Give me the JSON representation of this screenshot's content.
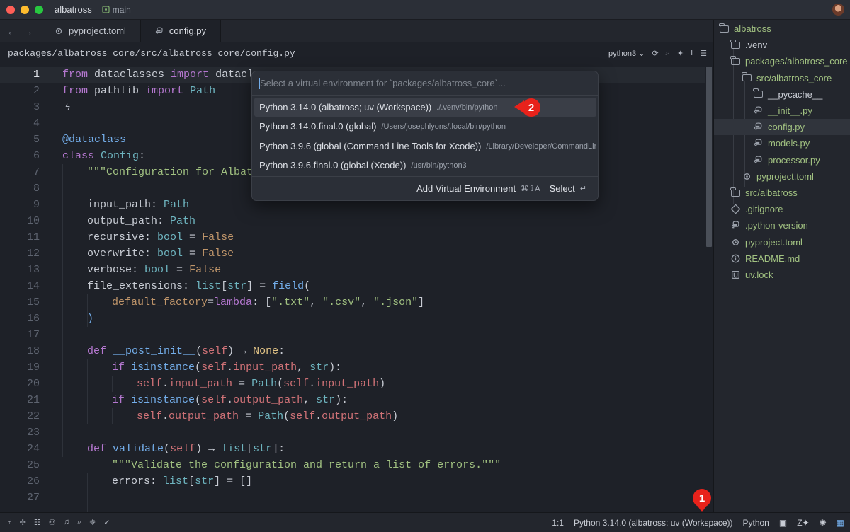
{
  "titlebar": {
    "project": "albatross",
    "branch": "main"
  },
  "tabs": [
    {
      "label": "pyproject.toml",
      "active": false
    },
    {
      "label": "config.py",
      "active": true
    }
  ],
  "breadcrumb": "packages/albatross_core/src/albatross_core/config.py",
  "toolbar": {
    "kernel": "python3"
  },
  "editor": {
    "current_line": 1,
    "lines": [
      {
        "n": "1"
      },
      {
        "n": "2"
      },
      {
        "n": "3"
      },
      {
        "n": "4"
      },
      {
        "n": "5"
      },
      {
        "n": "6"
      },
      {
        "n": "7"
      },
      {
        "n": "8"
      },
      {
        "n": "9"
      },
      {
        "n": "10"
      },
      {
        "n": "11"
      },
      {
        "n": "12"
      },
      {
        "n": "13"
      },
      {
        "n": "14"
      },
      {
        "n": "15"
      },
      {
        "n": "16"
      },
      {
        "n": "17"
      },
      {
        "n": "18"
      },
      {
        "n": "19"
      },
      {
        "n": "20"
      },
      {
        "n": "21"
      },
      {
        "n": "22"
      },
      {
        "n": "23"
      },
      {
        "n": "24"
      },
      {
        "n": "25"
      },
      {
        "n": "26"
      },
      {
        "n": "27"
      }
    ],
    "code": {
      "l1": [
        "from",
        " dataclasses ",
        "import",
        " datacla"
      ],
      "l2": [
        "from",
        " pathlib ",
        "import",
        " ",
        "Path"
      ],
      "l5": "@dataclass",
      "l6": [
        "class",
        " ",
        "Config",
        ":"
      ],
      "l7": "\"\"\"Configuration for Albatr",
      "l9": [
        "input_path",
        ": ",
        "Path"
      ],
      "l10": [
        "output_path",
        ": ",
        "Path"
      ],
      "l11": [
        "recursive",
        ": ",
        "bool",
        " = ",
        "False"
      ],
      "l12": [
        "overwrite",
        ": ",
        "bool",
        " = ",
        "False"
      ],
      "l13": [
        "verbose",
        ": ",
        "bool",
        " = ",
        "False"
      ],
      "l14": [
        "file_extensions",
        ": ",
        "list",
        "[",
        "str",
        "] = ",
        "field",
        "("
      ],
      "l15": [
        "default_factory",
        "=",
        "lambda",
        ": [",
        "\".txt\"",
        ", ",
        "\".csv\"",
        ", ",
        "\".json\"",
        "]"
      ],
      "l16": ")",
      "l18": [
        "def",
        " ",
        "__post_init__",
        "(",
        "self",
        ") ",
        "→",
        " ",
        "None",
        ":"
      ],
      "l19": [
        "if",
        " ",
        "isinstance",
        "(",
        "self",
        ".",
        "input_path",
        ", ",
        "str",
        "):"
      ],
      "l20": [
        "self",
        ".",
        "input_path",
        " = ",
        "Path",
        "(",
        "self",
        ".",
        "input_path",
        ")"
      ],
      "l21": [
        "if",
        " ",
        "isinstance",
        "(",
        "self",
        ".",
        "output_path",
        ", ",
        "str",
        "):"
      ],
      "l22": [
        "self",
        ".",
        "output_path",
        " = ",
        "Path",
        "(",
        "self",
        ".",
        "output_path",
        ")"
      ],
      "l24": [
        "def",
        " ",
        "validate",
        "(",
        "self",
        ") ",
        "→",
        " ",
        "list",
        "[",
        "str",
        "]:"
      ],
      "l25": "\"\"\"Validate the configuration and return a list of errors.\"\"\"",
      "l26": [
        "errors",
        ": ",
        "list",
        "[",
        "str",
        "] = []"
      ]
    }
  },
  "picker": {
    "placeholder": "Select a virtual environment for `packages/albatross_core`...",
    "options": [
      {
        "name": "Python 3.14.0 (albatross; uv (Workspace))",
        "path": "./.venv/bin/python",
        "selected": true
      },
      {
        "name": "Python 3.14.0.final.0 (global)",
        "path": "/Users/josephlyons/.local/bin/python",
        "selected": false
      },
      {
        "name": "Python 3.9.6 (global (Command Line Tools for Xcode))",
        "path": "/Library/Developer/CommandLin",
        "selected": false
      },
      {
        "name": "Python 3.9.6.final.0 (global (Xcode))",
        "path": "/usr/bin/python3",
        "selected": false
      }
    ],
    "add_label": "Add Virtual Environment",
    "add_shortcut": "⌘⇧A",
    "select_label": "Select",
    "select_shortcut": "↵"
  },
  "project_tree": [
    {
      "label": "albatross",
      "icon": "folder-icon",
      "depth": 0,
      "color": "green"
    },
    {
      "label": ".venv",
      "icon": "folder-icon",
      "depth": 1,
      "color": "default"
    },
    {
      "label": "packages/albatross_core",
      "icon": "folder-icon",
      "depth": 1,
      "color": "green"
    },
    {
      "label": "src/albatross_core",
      "icon": "folder-icon",
      "depth": 2,
      "color": "green"
    },
    {
      "label": "__pycache__",
      "icon": "folder-icon",
      "depth": 3,
      "color": "default"
    },
    {
      "label": "__init__.py",
      "icon": "python-file-icon",
      "depth": 3,
      "color": "green"
    },
    {
      "label": "config.py",
      "icon": "python-file-icon",
      "depth": 3,
      "color": "green",
      "selected": true
    },
    {
      "label": "models.py",
      "icon": "python-file-icon",
      "depth": 3,
      "color": "green"
    },
    {
      "label": "processor.py",
      "icon": "python-file-icon",
      "depth": 3,
      "color": "green"
    },
    {
      "label": "pyproject.toml",
      "icon": "settings-file-icon",
      "depth": 2,
      "color": "green"
    },
    {
      "label": "src/albatross",
      "icon": "folder-icon",
      "depth": 1,
      "color": "green"
    },
    {
      "label": ".gitignore",
      "icon": "git-icon",
      "depth": 1,
      "color": "green"
    },
    {
      "label": ".python-version",
      "icon": "python-file-icon",
      "depth": 1,
      "color": "green"
    },
    {
      "label": "pyproject.toml",
      "icon": "settings-file-icon",
      "depth": 1,
      "color": "green"
    },
    {
      "label": "README.md",
      "icon": "info-file-icon",
      "depth": 1,
      "color": "green"
    },
    {
      "label": "uv.lock",
      "icon": "lock-file-icon",
      "depth": 1,
      "color": "green"
    }
  ],
  "statusbar": {
    "cursor": "1:1",
    "environment": "Python 3.14.0 (albatross; uv (Workspace))",
    "language": "Python"
  },
  "annotations": {
    "badge1": "1",
    "badge2": "2"
  },
  "colors": {
    "accent": "#73ade9",
    "badge": "#e8221b",
    "tree_green": "#a1c181"
  }
}
